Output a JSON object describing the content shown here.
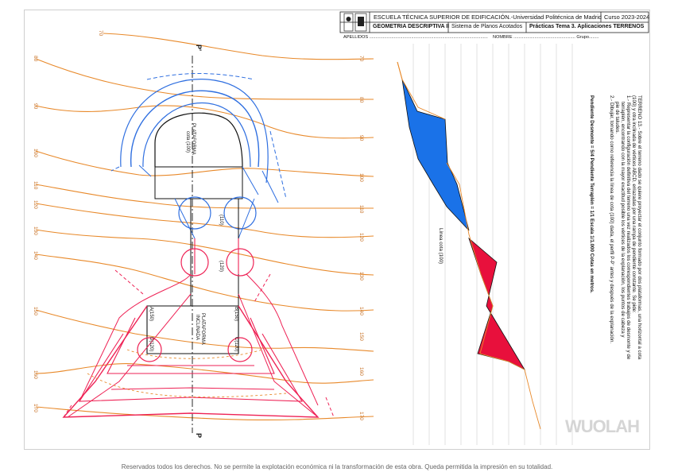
{
  "header": {
    "school": "ESCUELA TÉCNICA SUPERIOR DE EDIFICACIÓN.-Universidad Politécnica de Madrid",
    "course": "Curso 2023-2024",
    "subject": "GEOMETRIA DESCRIPTIVA II",
    "system": "Sistema de Planos Acotados",
    "practice": "Prácticas Tema 3. Aplicaciones TERRENOS",
    "surname_label": "APELLIDOS",
    "name_label": "NOMBRE",
    "group_label": "Grupo"
  },
  "statement": {
    "line1": "TERRENO 13.- Sobre el terreno dado se quiere proyectar el conjunto formado por dos plataformas, una horizontal a cota",
    "line2": "(100) y otra inclinada de vértices ABCD, enlazadas por una rampa de pendiente constante. Se pide:",
    "line3": "1.- Representar la configuración definitiva del terreno una vez realizados los correspondientes trabajos de desmonte y de",
    "line4": "terraplén, encontrando con la mayor exactitud posible los vértices de la explanación, los puntos de cabeza y",
    "line5": "pie de taludes.",
    "line6": "2.- Dibujar, tomando como referencia la línea de cota (100) dada, el perfil P-P' antes y después de la explanación.",
    "slopes": "Pendiente Desmonte = 5/4        Pendiente Terraplén = 1/1        Escala 1/1.000        Cotas en metros."
  },
  "contours_left": [
    "70",
    "80",
    "90",
    "100",
    "110",
    "120",
    "130",
    "140",
    "150",
    "160",
    "170"
  ],
  "contours_right": [
    "70",
    "80",
    "90",
    "100",
    "110",
    "120",
    "130",
    "140",
    "150",
    "160",
    "170"
  ],
  "labels": {
    "plataforma_top": "PLATAFORMA",
    "cota_top": "cota (100)",
    "plataforma_bottom": "PLATAFORMA",
    "inclinada": "INCLINADA",
    "ramp_110": "(110)",
    "ramp_120": "(120)",
    "A": "A(150)",
    "B": "B(150)",
    "C": "C(120)",
    "D": "D(120)",
    "P_top": "P'",
    "P_bottom": "P",
    "linea_cota": "Línea cota (100)"
  },
  "colors": {
    "contour": "#e8892a",
    "desmonte": "#2f6fe0",
    "terraplen": "#ee2255",
    "profile_cut": "#1a72e8",
    "profile_fill": "#e8103c"
  },
  "watermark": "WUOLAH",
  "footer": "Reservados todos los derechos. No se permite la explotación económica ni la transformación de esta obra. Queda permitida la impresión en su totalidad."
}
